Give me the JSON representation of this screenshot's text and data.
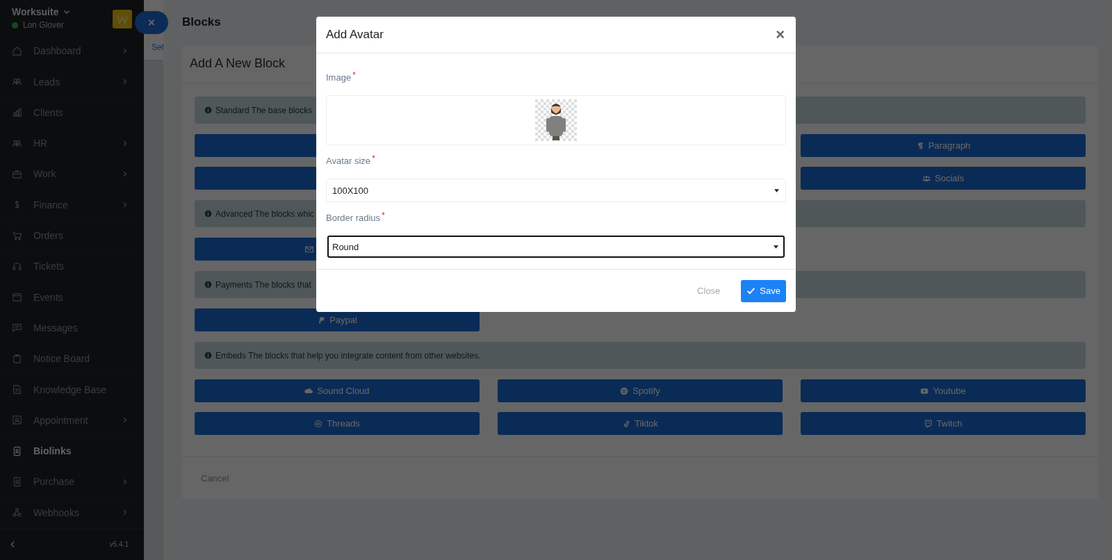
{
  "sidebar": {
    "brand": "Worksuite",
    "user": "Lon Glover",
    "user_online": true,
    "items": [
      {
        "label": "Dashboard",
        "expandable": true,
        "selected": false
      },
      {
        "label": "Leads",
        "expandable": true,
        "selected": false
      },
      {
        "label": "Clients",
        "expandable": false,
        "selected": false
      },
      {
        "label": "HR",
        "expandable": true,
        "selected": false
      },
      {
        "label": "Work",
        "expandable": true,
        "selected": false
      },
      {
        "label": "Finance",
        "expandable": true,
        "selected": false
      },
      {
        "label": "Orders",
        "expandable": false,
        "selected": false
      },
      {
        "label": "Tickets",
        "expandable": false,
        "selected": false
      },
      {
        "label": "Events",
        "expandable": false,
        "selected": false
      },
      {
        "label": "Messages",
        "expandable": false,
        "selected": false
      },
      {
        "label": "Notice Board",
        "expandable": false,
        "selected": false
      },
      {
        "label": "Knowledge Base",
        "expandable": false,
        "selected": false
      },
      {
        "label": "Appointment",
        "expandable": true,
        "selected": false
      },
      {
        "label": "Biolinks",
        "expandable": false,
        "selected": true
      },
      {
        "label": "Purchase",
        "expandable": true,
        "selected": false
      },
      {
        "label": "Webhooks",
        "expandable": true,
        "selected": false
      }
    ],
    "version": "v5.4.1",
    "close": "×"
  },
  "subnav": {
    "link": "Set"
  },
  "page_title": "Blocks",
  "card": {
    "title": "Add A New Block",
    "sections": [
      {
        "note": "Standard The base blocks",
        "rows": [
          {
            "left": {},
            "right": {
              "label": "Paragraph"
            }
          },
          {
            "left": {},
            "right": {
              "label": "Socials"
            }
          }
        ]
      },
      {
        "note": "Advanced The blocks whic",
        "rows": [
          {
            "left": {}
          }
        ]
      },
      {
        "note": "Payments The blocks that",
        "rows": [
          {
            "left": {
              "label": "Paypal"
            }
          }
        ]
      },
      {
        "note": "Embeds The blocks that help you integrate content from other websites.",
        "rows": [
          {
            "left": {
              "label": "Sound Cloud"
            },
            "center": {
              "label": "Spotify"
            },
            "right": {
              "label": "Youtube"
            }
          },
          {
            "left": {
              "label": "Threads"
            },
            "center": {
              "label": "Tiktok"
            },
            "right": {
              "label": "Twitch"
            }
          }
        ]
      }
    ],
    "cancel": "Cancel"
  },
  "modal": {
    "title": "Add Avatar",
    "close": "×",
    "fields": [
      {
        "label": "Image",
        "required": true
      },
      {
        "kind": "select",
        "label": "Avatar size",
        "required": true,
        "value": "100X100",
        "focused": false
      },
      {
        "kind": "select",
        "label": "Border radius",
        "required": true,
        "value": "Round",
        "focused": true
      }
    ],
    "close_button": "Close",
    "save_button": "Save"
  }
}
